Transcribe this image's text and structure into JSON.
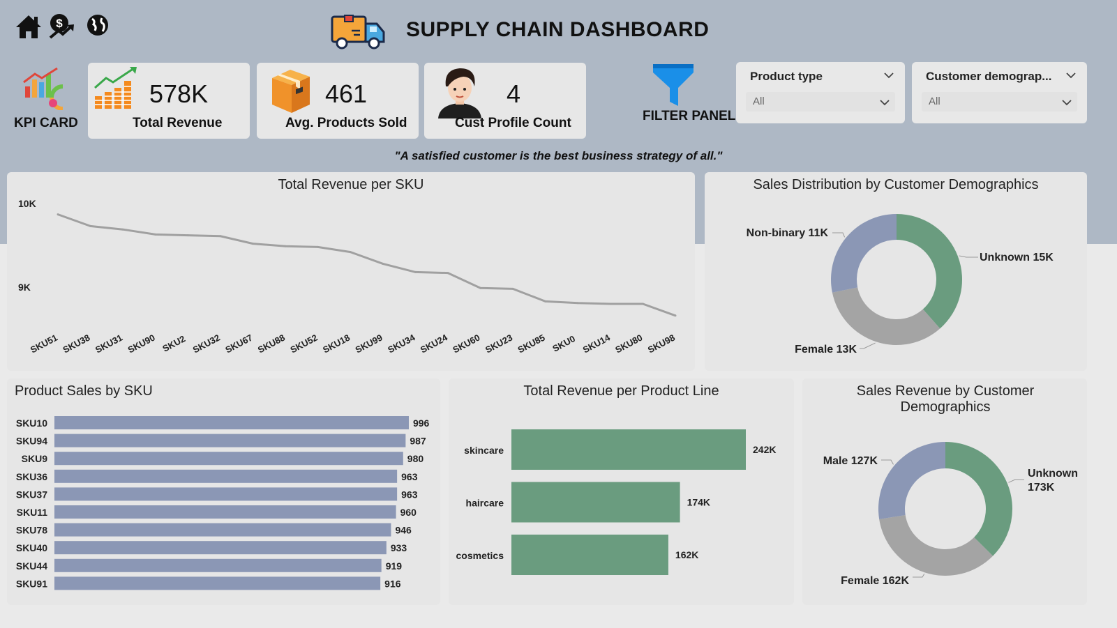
{
  "header": {
    "title": "SUPPLY CHAIN DASHBOARD",
    "nav_icons": [
      "home-icon",
      "sales-icon",
      "globe-icon"
    ],
    "quote": "\"A satisfied customer is the best business strategy of all.\""
  },
  "kpi": {
    "section_label": "KPI CARD",
    "cards": [
      {
        "value": "578K",
        "label": "Total Revenue",
        "icon": "revenue-chart-icon"
      },
      {
        "value": "461",
        "label": "Avg. Products Sold",
        "icon": "box-icon"
      },
      {
        "value": "4",
        "label": "Cust Profile Count",
        "icon": "person-icon"
      }
    ]
  },
  "filters": {
    "panel_label": "FILTER PANEL",
    "items": [
      {
        "label": "Product type",
        "value": "All"
      },
      {
        "label": "Customer demograp...",
        "value": "All"
      }
    ]
  },
  "colors": {
    "band": "#aeb8c5",
    "bar_blue": "#8b97b5",
    "bar_green": "#6a9c7f",
    "line": "#a0a0a0",
    "donut_green": "#6a9c7f",
    "donut_grey": "#a4a4a4",
    "donut_blue": "#8b97b5"
  },
  "chart_data": [
    {
      "type": "line",
      "title": "Total Revenue per SKU",
      "categories": [
        "SKU51",
        "SKU38",
        "SKU31",
        "SKU90",
        "SKU2",
        "SKU32",
        "SKU67",
        "SKU88",
        "SKU52",
        "SKU18",
        "SKU99",
        "SKU34",
        "SKU24",
        "SKU60",
        "SKU23",
        "SKU85",
        "SKU0",
        "SKU14",
        "SKU80",
        "SKU98"
      ],
      "values": [
        9870,
        9730,
        9690,
        9630,
        9620,
        9610,
        9520,
        9490,
        9480,
        9420,
        9280,
        9180,
        9170,
        8990,
        8980,
        8830,
        8810,
        8800,
        8800,
        8660
      ],
      "yticks": [
        {
          "value": 10000,
          "label": "10K"
        },
        {
          "value": 9000,
          "label": "9K"
        }
      ],
      "ylim": [
        8600,
        10000
      ]
    },
    {
      "type": "pie",
      "title": "Sales Distribution by Customer Demographics",
      "slices": [
        {
          "name": "Unknown",
          "value": 15,
          "label": "Unknown 15K"
        },
        {
          "name": "Female",
          "value": 13,
          "label": "Female 13K"
        },
        {
          "name": "Non-binary",
          "value": 11,
          "label": "Non-binary 11K"
        }
      ]
    },
    {
      "type": "bar",
      "title": "Product Sales by SKU",
      "categories": [
        "SKU10",
        "SKU94",
        "SKU9",
        "SKU36",
        "SKU37",
        "SKU11",
        "SKU78",
        "SKU40",
        "SKU44",
        "SKU91"
      ],
      "values": [
        996,
        987,
        980,
        963,
        963,
        960,
        946,
        933,
        919,
        916
      ],
      "labels": [
        "996",
        "987",
        "980",
        "963",
        "963",
        "960",
        "946",
        "933",
        "919",
        "916"
      ],
      "xlim": [
        0,
        1000
      ]
    },
    {
      "type": "bar",
      "title": "Total Revenue per Product Line",
      "categories": [
        "skincare",
        "haircare",
        "cosmetics"
      ],
      "values": [
        242,
        174,
        162
      ],
      "labels": [
        "242K",
        "174K",
        "162K"
      ],
      "xlim": [
        0,
        242
      ]
    },
    {
      "type": "pie",
      "title": "Sales Revenue by Customer Demographics",
      "slices": [
        {
          "name": "Unknown",
          "value": 173,
          "label": [
            "Unknown",
            "173K"
          ]
        },
        {
          "name": "Female",
          "value": 162,
          "label": [
            "Female 162K"
          ]
        },
        {
          "name": "Male",
          "value": 127,
          "label": [
            "Male 127K"
          ]
        }
      ]
    }
  ]
}
